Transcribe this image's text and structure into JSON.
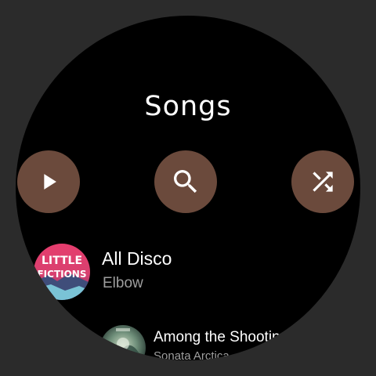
{
  "screen": {
    "title": "Songs"
  },
  "actions": [
    {
      "icon": "play-icon"
    },
    {
      "icon": "search-icon"
    },
    {
      "icon": "shuffle-icon"
    }
  ],
  "songs": [
    {
      "title": "All Disco",
      "artist": "Elbow",
      "album_art_text": "LITTLE FICTIONS"
    },
    {
      "title": "Among the Shooting Stars",
      "artist": "Sonata Arctica"
    }
  ],
  "colors": {
    "button_bg": "#6b4a3c",
    "screen_bg": "#000000",
    "bezel": "#2b2b2b",
    "secondary_text": "#9e9e9e"
  }
}
